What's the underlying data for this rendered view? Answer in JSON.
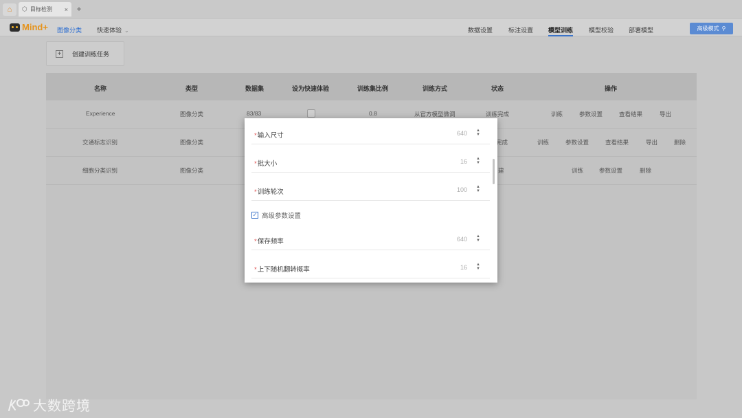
{
  "tabs": {
    "home_icon": "home-icon",
    "doc_tab_label": "目标检测",
    "close_glyph": "×",
    "new_tab_glyph": "+"
  },
  "header": {
    "logo_text": "Mind+",
    "mode_link": "图像分类",
    "quick_experience": "快速体验",
    "nav": [
      "数据设置",
      "标注设置",
      "模型训练",
      "模型校验",
      "部署模型"
    ],
    "active_nav": "模型训练",
    "advanced_mode_button": "高级模式",
    "accent_color": "#3c74c9"
  },
  "toolbar": {
    "create_task_label": "创建训练任务"
  },
  "table": {
    "columns": [
      "名称",
      "类型",
      "数据集",
      "设为快速体验",
      "训练集比例",
      "训练方式",
      "状态",
      "操作"
    ],
    "rows": [
      {
        "name": "Experience",
        "type": "图像分类",
        "dataset": "83/83",
        "quick": false,
        "ratio": "0.8",
        "method": "从官方模型微调",
        "status": "训练完成",
        "actions": [
          "训练",
          "参数设置",
          "查看结果",
          "导出"
        ]
      },
      {
        "name": "交通标志识别",
        "type": "图像分类",
        "status": "完成",
        "actions": [
          "训练",
          "参数设置",
          "查看结果",
          "导出",
          "删除"
        ]
      },
      {
        "name": "细胞分类识别",
        "type": "图像分类",
        "status": "建",
        "actions": [
          "训练",
          "参数设置",
          "删除"
        ]
      }
    ]
  },
  "modal": {
    "fields": [
      {
        "label": "输入尺寸",
        "value": "640"
      },
      {
        "label": "批大小",
        "value": "16"
      },
      {
        "label": "训练轮次",
        "value": "100"
      }
    ],
    "advanced_checkbox_label": "高级参数设置",
    "advanced_checked": true,
    "advanced_fields": [
      {
        "label": "保存频率",
        "value": "640"
      },
      {
        "label": "上下随机翻转概率",
        "value": "16"
      }
    ],
    "required_mark": "*"
  },
  "watermark": {
    "text": "大数跨境"
  }
}
